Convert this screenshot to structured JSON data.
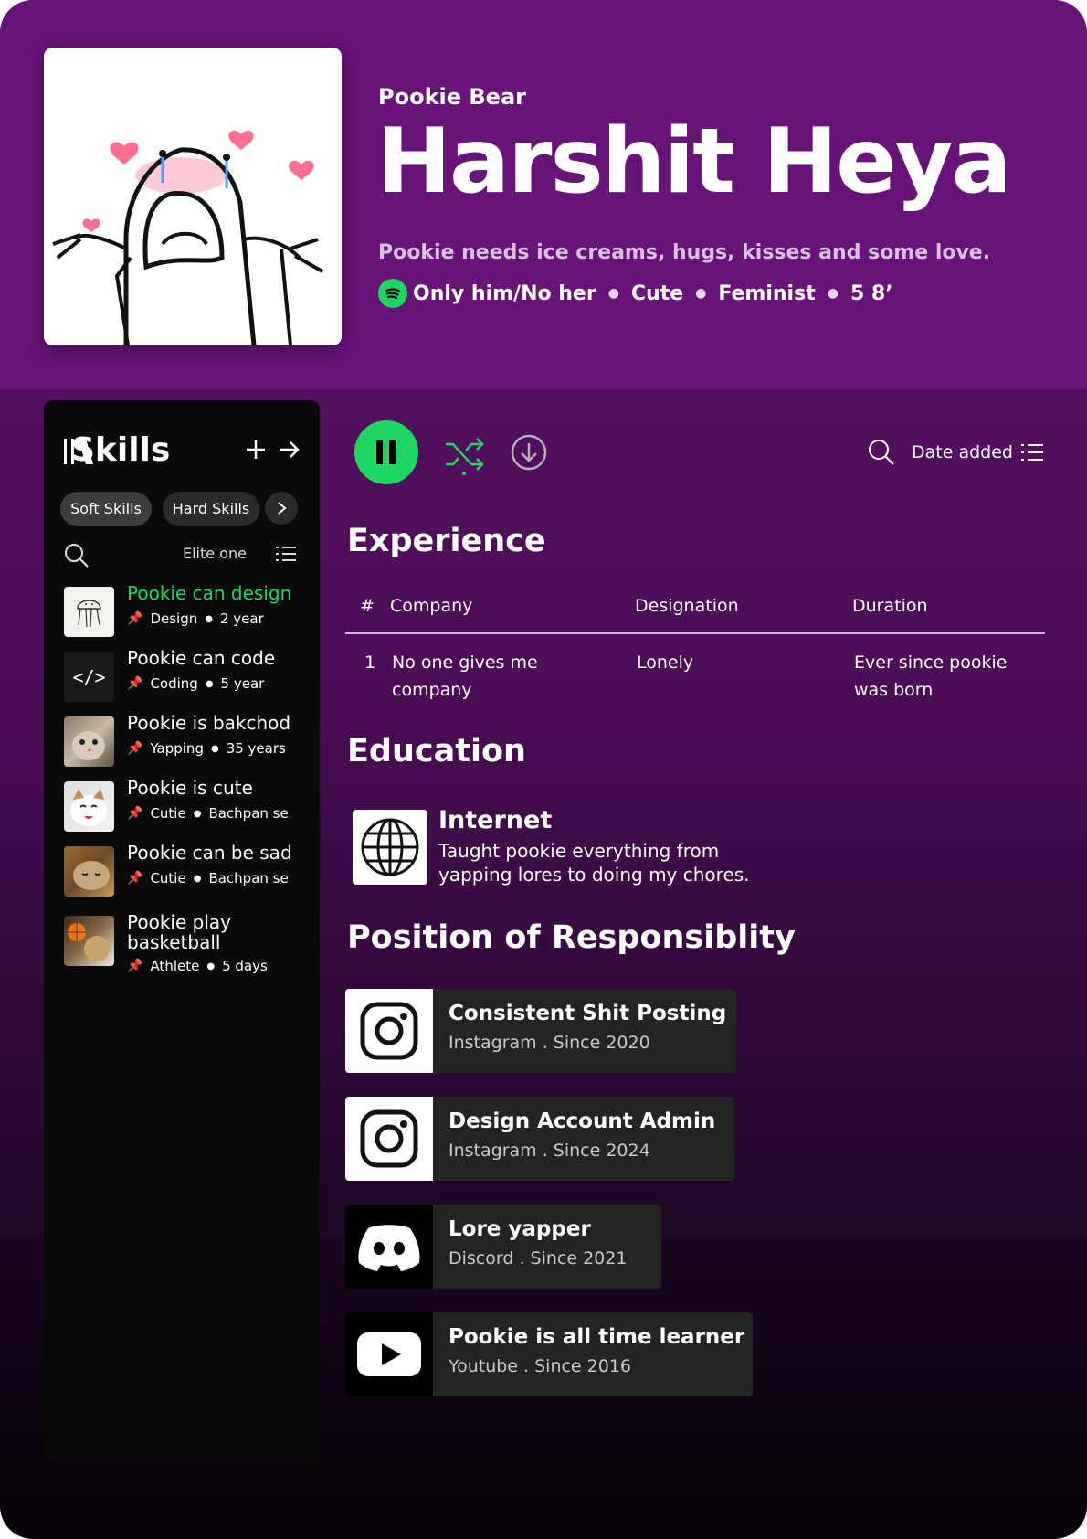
{
  "profile": {
    "subtitle": "Pookie Bear",
    "name": "Harshit Heya",
    "tagline": "Pookie needs ice creams, hugs, kisses and some love.",
    "meta": [
      "Only him/No her",
      "Cute",
      "Feminist",
      "5 8’"
    ]
  },
  "sidebar": {
    "title": "Skills",
    "chips": [
      "Soft Skills",
      "Hard Skills"
    ],
    "sort_label": "Elite one",
    "skills": [
      {
        "name": "Pookie can design",
        "category": "Design",
        "duration": "2 year",
        "thumb": "jellyfish-sketch"
      },
      {
        "name": "Pookie can code",
        "category": "Coding",
        "duration": "5 year",
        "thumb": "code-icon"
      },
      {
        "name": "Pookie is bakchod",
        "category": "Yapping",
        "duration": "35 years",
        "thumb": "cat-photo"
      },
      {
        "name": "Pookie is cute",
        "category": "Cutie",
        "duration": "Bachpan se",
        "thumb": "cat-photo"
      },
      {
        "name": "Pookie can be sad",
        "category": "Cutie",
        "duration": "Bachpan se",
        "thumb": "cat-photo"
      },
      {
        "name": "Pookie play basketball",
        "category": "Athlete",
        "duration": "5 days",
        "thumb": "cat-basketball-photo"
      }
    ]
  },
  "toolbar": {
    "sort_label": "Date added"
  },
  "experience": {
    "heading": "Experience",
    "columns": [
      "#",
      "Company",
      "Designation",
      "Duration"
    ],
    "rows": [
      {
        "index": "1",
        "company": "No one gives me company",
        "designation": "Lonely",
        "duration": "Ever since pookie was born"
      }
    ]
  },
  "education": {
    "heading": "Education",
    "title": "Internet",
    "description": "Taught pookie everything from yapping lores to doing my chores.",
    "icon": "globe-icon"
  },
  "responsibility": {
    "heading": "Position of Responsiblity",
    "items": [
      {
        "title": "Consistent Shit Posting",
        "subtitle": "Instagram . Since 2020",
        "icon": "instagram-icon"
      },
      {
        "title": "Design Account Admin",
        "subtitle": "Instagram . Since 2024",
        "icon": "instagram-icon"
      },
      {
        "title": "Lore yapper",
        "subtitle": "Discord . Since 2021",
        "icon": "discord-icon"
      },
      {
        "title": "Pookie is all time learner",
        "subtitle": "Youtube . Since 2016",
        "icon": "youtube-icon"
      }
    ]
  },
  "colors": {
    "accent": "#1ed760",
    "header": "#671478",
    "sidebar": "#0a0a0a",
    "card": "#242424"
  }
}
